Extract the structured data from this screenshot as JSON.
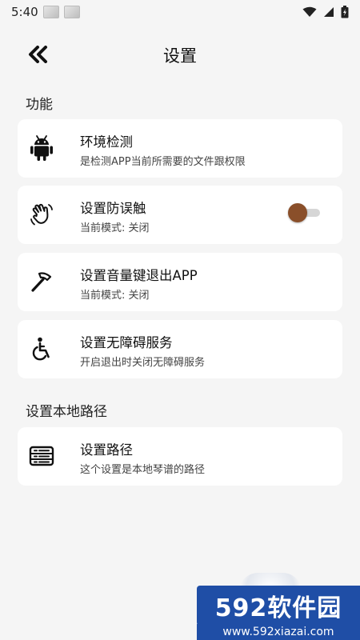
{
  "status_bar": {
    "time": "5:40"
  },
  "header": {
    "title": "设置"
  },
  "sections": {
    "features": {
      "title": "功能",
      "items": [
        {
          "title": "环境检测",
          "subtitle": "是检测APP当前所需要的文件跟权限",
          "icon": "android-icon"
        },
        {
          "title": "设置防误触",
          "subtitle": "当前模式: 关闭",
          "icon": "wave-hand-icon",
          "toggle_on": false
        },
        {
          "title": "设置音量键退出APP",
          "subtitle": "当前模式: 关闭",
          "icon": "hammer-icon"
        },
        {
          "title": "设置无障碍服务",
          "subtitle": "开启退出时关闭无障碍服务",
          "icon": "accessibility-icon"
        }
      ]
    },
    "local_path": {
      "title": "设置本地路径",
      "items": [
        {
          "title": "设置路径",
          "subtitle": "这个设置是本地琴谱的路径",
          "icon": "storage-icon"
        }
      ]
    }
  },
  "watermark": {
    "brand": "592软件园",
    "url": "www.592xiazai.com"
  },
  "colors": {
    "background": "#f5f5f5",
    "card": "#ffffff",
    "toggle_thumb": "#8a4f2a",
    "toggle_track": "#d6d6d6",
    "watermark_blue": "#1f4ea6",
    "watermark_yellow": "#ffd400"
  }
}
